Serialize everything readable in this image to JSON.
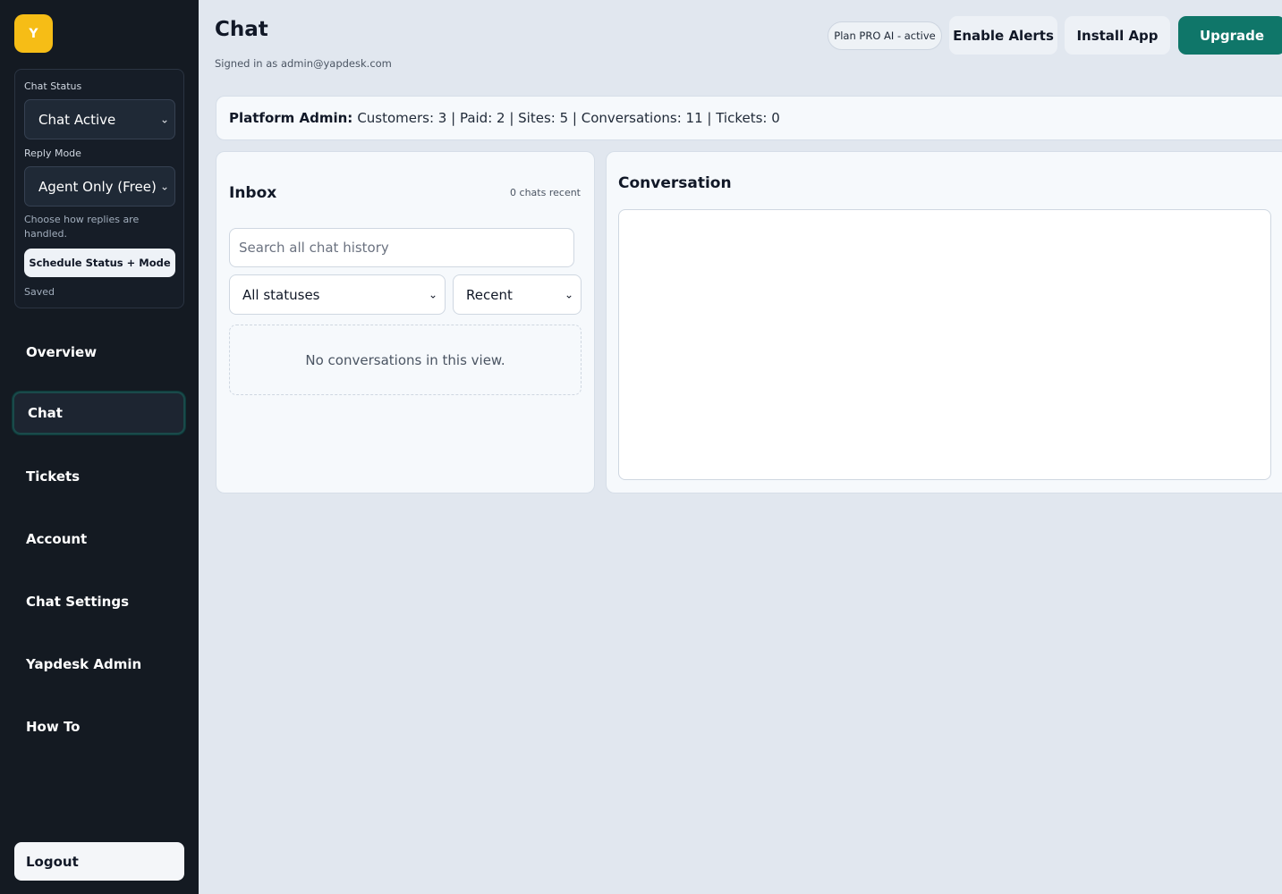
{
  "sidebar": {
    "logo_letter": "Y",
    "chat_status": {
      "label": "Chat Status",
      "value": "Chat Active"
    },
    "reply_mode": {
      "label": "Reply Mode",
      "value": "Agent Only (Free)",
      "help": "Choose how replies are handled."
    },
    "schedule_button": "Schedule Status + Mode",
    "saved_text": "Saved",
    "nav": [
      {
        "label": "Overview"
      },
      {
        "label": "Chat",
        "active": true
      },
      {
        "label": "Tickets"
      },
      {
        "label": "Account"
      },
      {
        "label": "Chat Settings"
      },
      {
        "label": "Yapdesk Admin"
      },
      {
        "label": "How To"
      }
    ],
    "logout": "Logout"
  },
  "header": {
    "title": "Chat",
    "signed_in": "Signed in as admin@yapdesk.com",
    "plan_badge": "Plan PRO AI - active",
    "enable_alerts": "Enable Alerts",
    "install_app": "Install App",
    "upgrade": "Upgrade"
  },
  "stats": {
    "label": "Platform Admin:",
    "text": "Customers: 3 | Paid: 2 | Sites: 5 | Conversations: 11 | Tickets: 0"
  },
  "inbox": {
    "title": "Inbox",
    "recent_count": "0 chats recent",
    "search_placeholder": "Search all chat history",
    "status_filter": "All statuses",
    "sort_filter": "Recent",
    "empty_text": "No conversations in this view."
  },
  "conversation": {
    "title": "Conversation"
  },
  "colors": {
    "accent": "#0f7669",
    "logo": "#f6bd16",
    "sidebar_bg": "#141a22",
    "page_bg": "#e1e7ef"
  },
  "icons": {
    "select_caret": "chevron-down-icon"
  }
}
